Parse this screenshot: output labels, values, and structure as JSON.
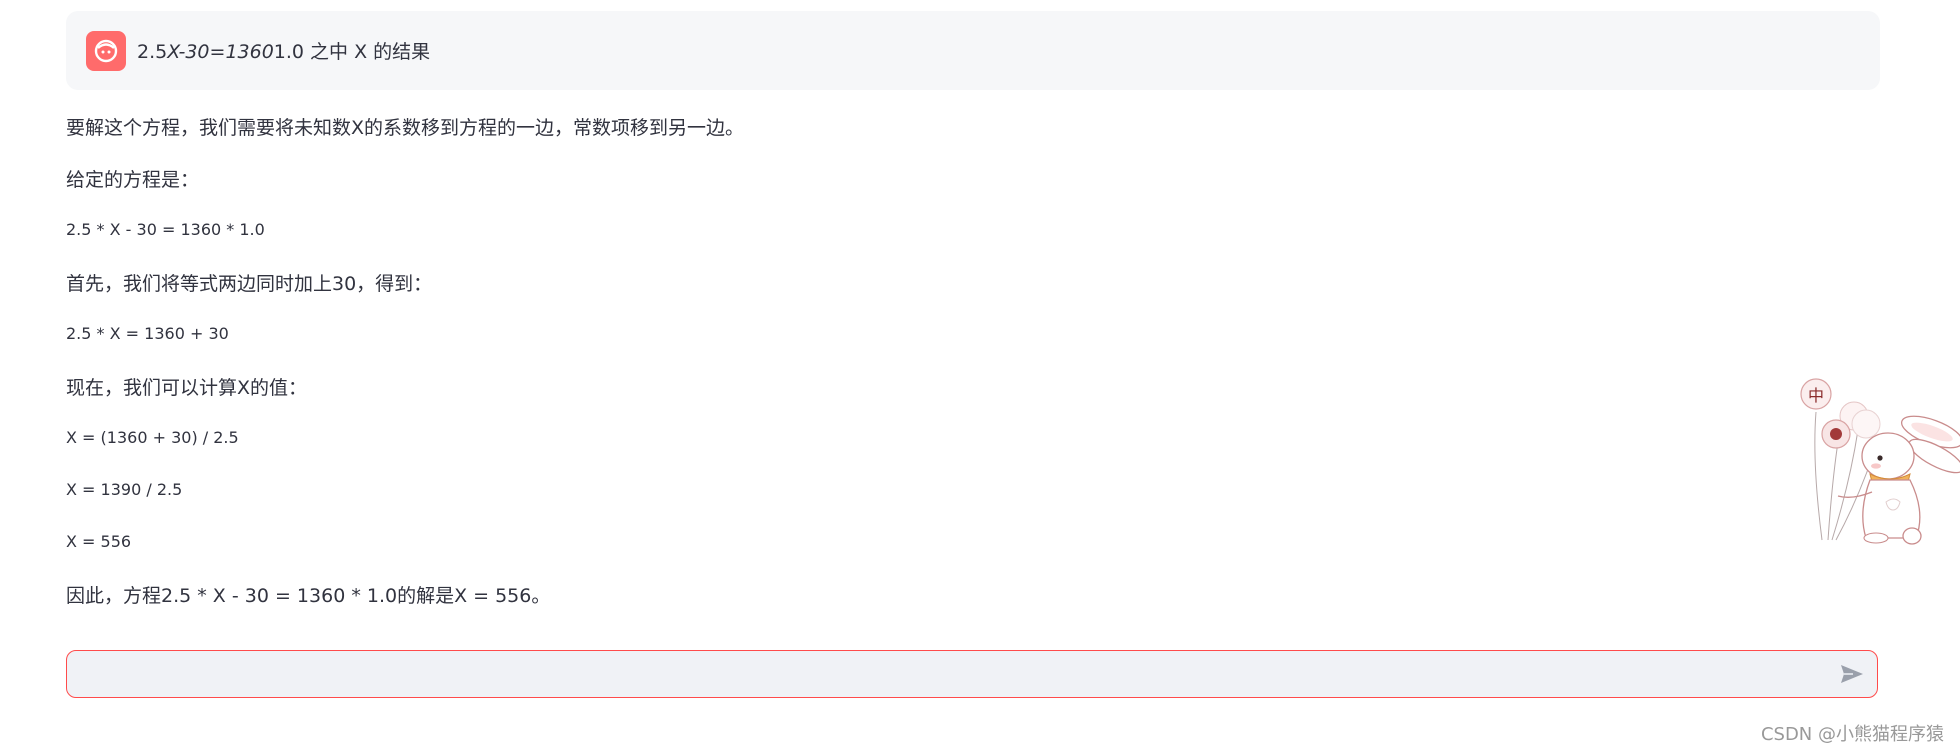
{
  "user_message": {
    "prefix": "2.5",
    "italic_part": "X-30=1360",
    "suffix": "1.0 之中 X 的结果"
  },
  "answer": {
    "p1": "要解这个方程，我们需要将未知数X的系数移到方程的一边，常数项移到另一边。",
    "p2": "给定的方程是：",
    "p3": "2.5 * X - 30 = 1360 * 1.0",
    "p4": "首先，我们将等式两边同时加上30，得到：",
    "p5": "2.5 * X = 1360 + 30",
    "p6": "现在，我们可以计算X的值：",
    "p7": "X = (1360 + 30) / 2.5",
    "p8": "X = 1390 / 2.5",
    "p9": "X = 556",
    "p10": "因此，方程2.5 * X - 30 = 1360 * 1.0的解是X = 556。"
  },
  "chat_input": {
    "value": "",
    "placeholder": ""
  },
  "mascot": {
    "balloon_text": "中"
  },
  "watermark": "CSDN @小熊猫程序猿",
  "colors": {
    "accent": "#ff4b4b",
    "avatar_bg": "#ff6b6b",
    "user_bubble_bg": "#f6f7f9",
    "input_bg": "#f0f2f6",
    "text": "#31333f"
  }
}
